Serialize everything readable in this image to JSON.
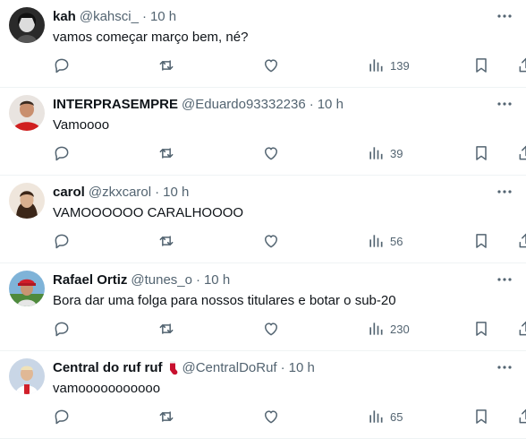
{
  "tweets": [
    {
      "name": "kah",
      "handle": "@kahsci_",
      "time": "10 h",
      "text": "vamos começar março bem, né?",
      "views": "139",
      "avatar": "avatar-kah",
      "badge": false
    },
    {
      "name": "INTERPRASEMPRE",
      "handle": "@Eduardo93332236",
      "time": "10 h",
      "text": "Vamoooo",
      "views": "39",
      "avatar": "avatar-interprasempre",
      "badge": false
    },
    {
      "name": "carol",
      "handle": "@zkxcarol",
      "time": "10 h",
      "text": "VAMOOOOOO CARALHOOOO",
      "views": "56",
      "avatar": "avatar-carol",
      "badge": false
    },
    {
      "name": "Rafael Ortiz",
      "handle": "@tunes_o",
      "time": "10 h",
      "text": "Bora dar uma folga para nossos titulares e botar o sub-20",
      "views": "230",
      "avatar": "avatar-rafael",
      "badge": false
    },
    {
      "name": "Central do ruf ruf",
      "handle": "@CentralDoRuf",
      "time": "10 h",
      "text": "vamooooooooooo",
      "views": "65",
      "avatar": "avatar-central",
      "badge": true
    }
  ],
  "separator": "·",
  "colors": {
    "text": "#0f1419",
    "secondary": "#536471",
    "divider": "#eff3f4",
    "badge": "#c8102e"
  }
}
